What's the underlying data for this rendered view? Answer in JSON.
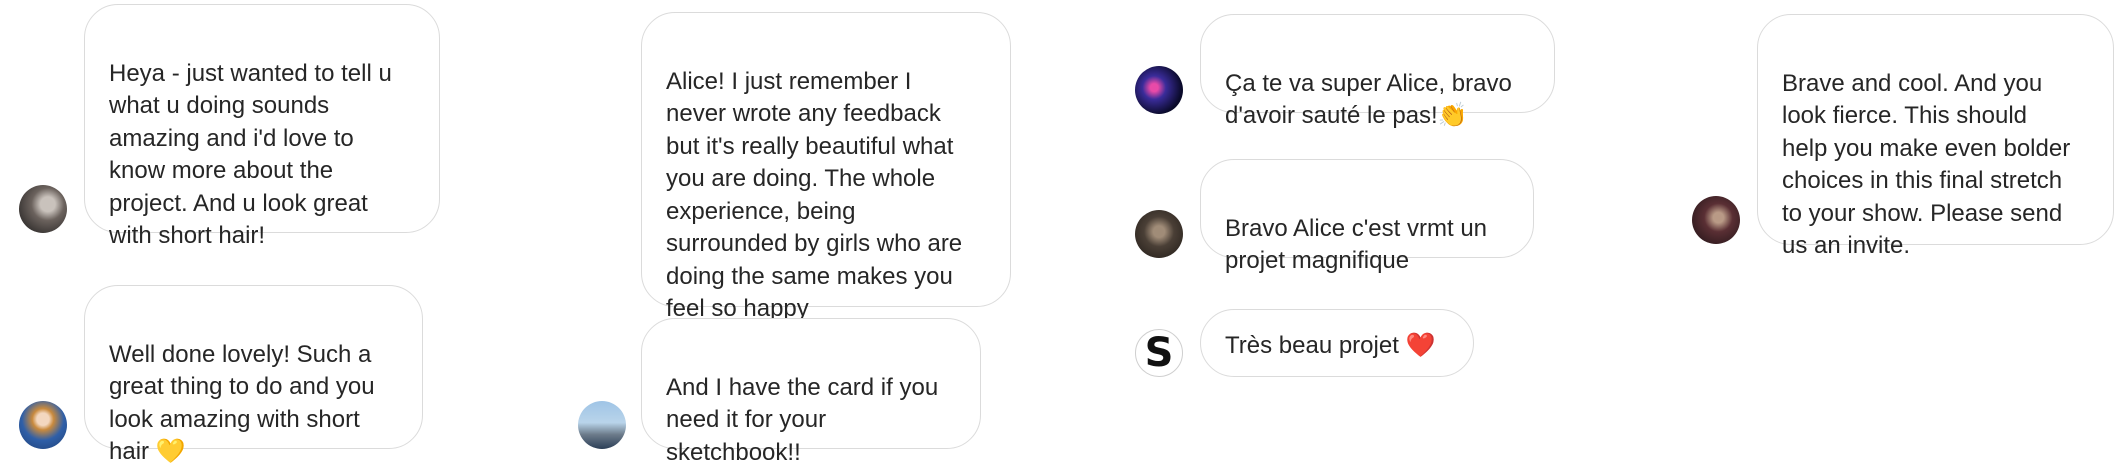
{
  "messages": [
    {
      "id": "m1",
      "text": "Heya - just wanted to tell u\nwhat u doing sounds\namazing and i'd love to\nknow more about the\nproject. And u look great\nwith short hair!"
    },
    {
      "id": "m2",
      "text": "Well done lovely! Such a\ngreat thing to do and you\nlook amazing with short\nhair 💛"
    },
    {
      "id": "m3",
      "text": "Alice! I just remember I\nnever wrote any feedback\nbut it's really beautiful what\nyou are doing. The whole\nexperience, being\nsurrounded by girls who are\ndoing the same makes you\nfeel so happy"
    },
    {
      "id": "m4",
      "text": "And I have the card if you\nneed it for your\nsketchbook!!"
    },
    {
      "id": "m5",
      "text": "Ça te va super Alice, bravo\nd'avoir sauté le pas!👏"
    },
    {
      "id": "m6",
      "text": "Bravo Alice c'est vrmt un\nprojet magnifique"
    },
    {
      "id": "m7",
      "text": "Très beau projet ❤️",
      "avatar_letter": "S"
    },
    {
      "id": "m8",
      "text": "Brave and cool. And you\nlook fierce. This should\nhelp you make even bolder\nchoices in this final stretch\nto your show. Please send\nus an invite."
    }
  ],
  "colors": {
    "bubble_border": "#dbdbdb",
    "text": "#262626",
    "background": "#ffffff"
  }
}
